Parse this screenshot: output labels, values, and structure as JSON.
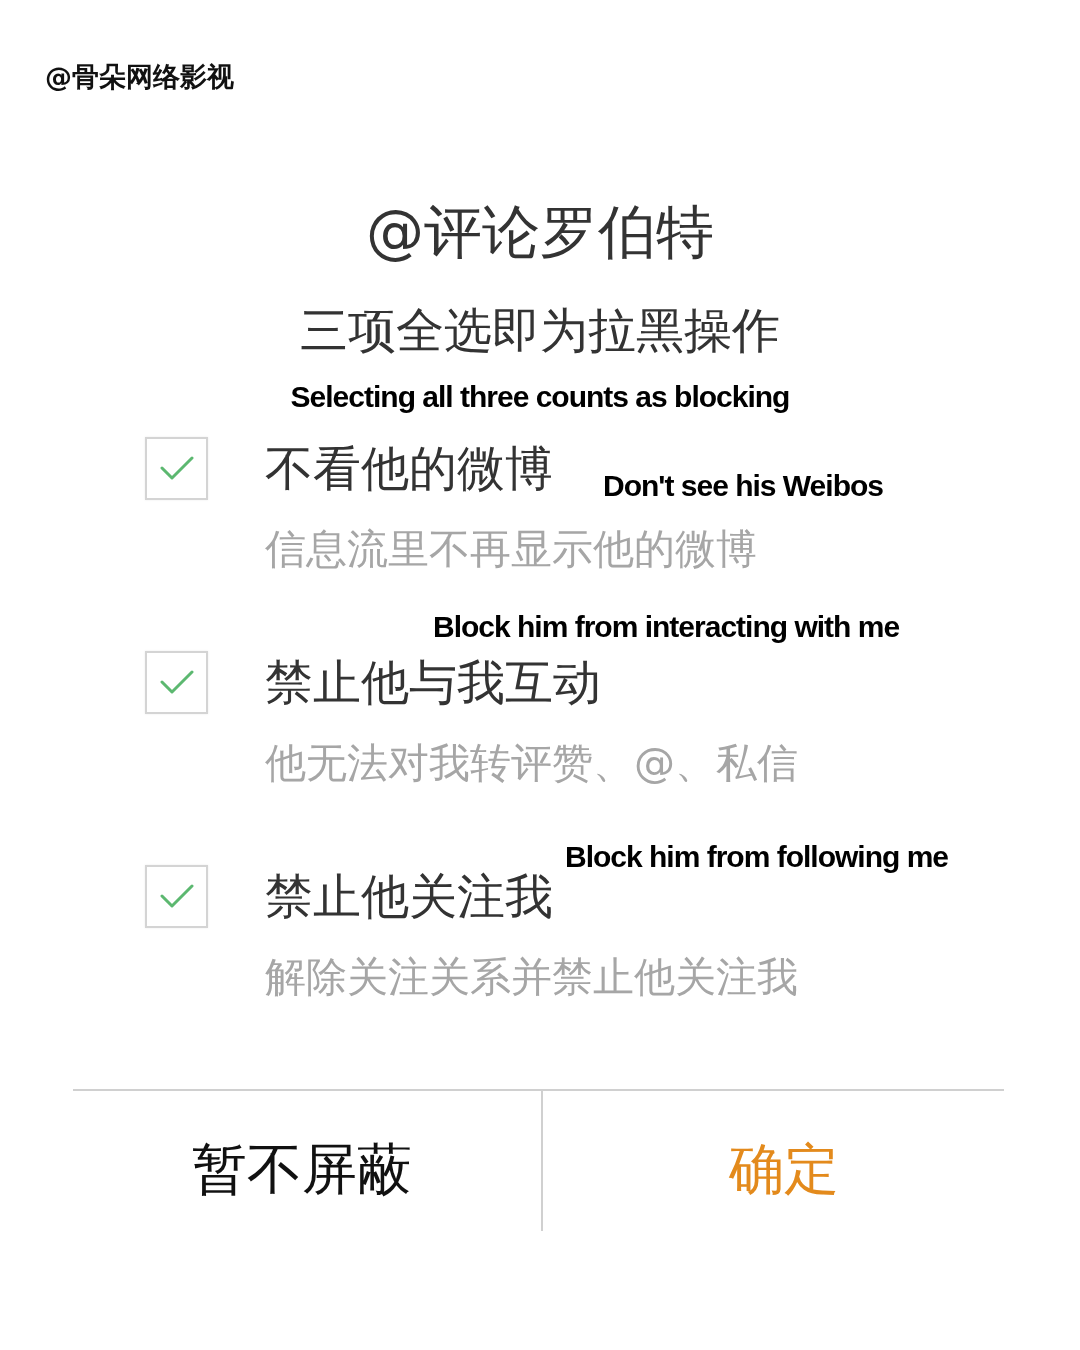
{
  "credit": "@骨朵网络影视",
  "dialog": {
    "title": "@评论罗伯特",
    "subtitle": "三项全选即为拉黑操作",
    "subtitle_translation": "Selecting all three counts as blocking",
    "options": [
      {
        "label": "不看他的微博",
        "description": "信息流里不再显示他的微博",
        "translation": "Don't see his Weibos",
        "checked": true
      },
      {
        "label": "禁止他与我互动",
        "description": "他无法对我转评赞、@、私信",
        "translation": "Block him from interacting with me",
        "checked": true
      },
      {
        "label": "禁止他关注我",
        "description": "解除关注关系并禁止他关注我",
        "translation": "Block him from following me",
        "checked": true
      }
    ],
    "buttons": [
      {
        "label": "暂不屏蔽",
        "kind": "cancel"
      },
      {
        "label": "确定",
        "kind": "confirm"
      }
    ]
  }
}
